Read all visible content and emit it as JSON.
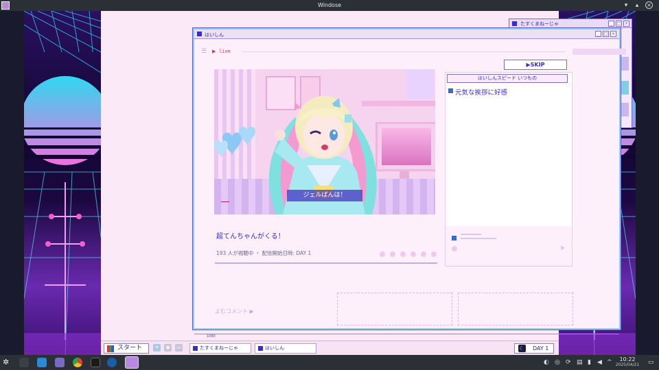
{
  "host": {
    "window_title": "Windose",
    "clock_time": "10:22",
    "clock_date": "2025/04/21"
  },
  "tasks_window": {
    "title": "たすくまねーじゃ"
  },
  "main_window": {
    "title": "はいしん",
    "live_label": "live",
    "skip_label": "▶SKIP",
    "stream_caption": "ジェルばんは！",
    "stream_title": "超てんちゃんがくる！",
    "viewer_text": "193 人が視聴中 ・ 配信開始日時: DAY 1",
    "chat_header": "はいしんスピード いつもの",
    "chat_message": "元気な挨拶に好感",
    "comment_label": "よむコメント ▶",
    "bottom_label": "1080"
  },
  "game_taskbar": {
    "start_label": "スタート",
    "tasks": [
      "たすくまねーじゃ",
      "はいしん"
    ],
    "day_label": "DAY 1"
  },
  "colors": {
    "accent": "#3a2ad0",
    "window_border": "#8ad0e8",
    "background": "#fbe9f7",
    "live_red": "#e0304a"
  }
}
